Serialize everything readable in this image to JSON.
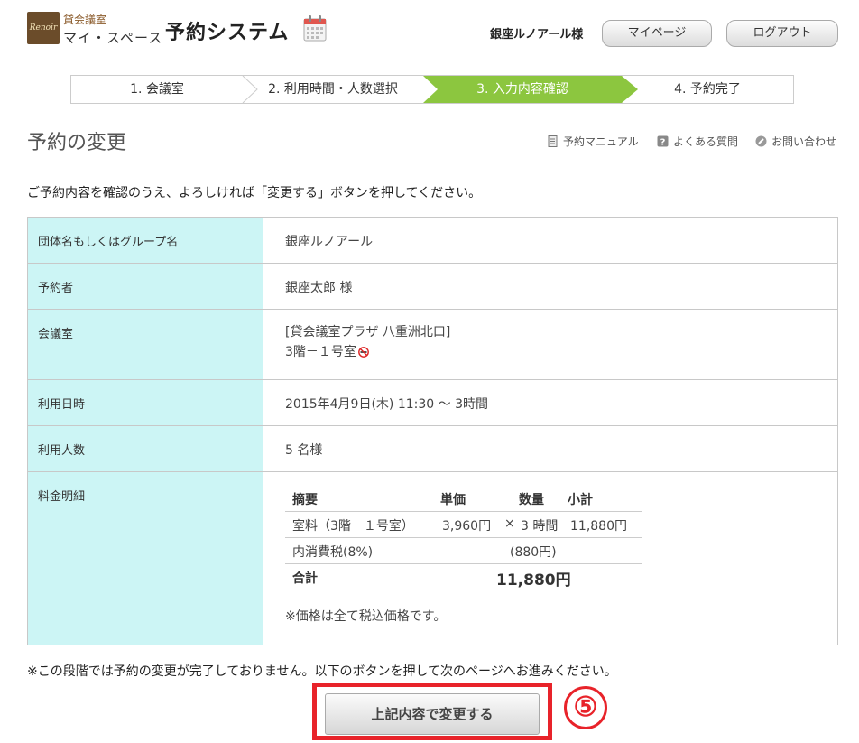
{
  "header": {
    "logo_text": "Renoir",
    "logo_category": "貸会議室",
    "logo_name": "マイ・スペース",
    "system_title": "予約システム",
    "user_name": "銀座ルノアール様",
    "mypage_label": "マイページ",
    "logout_label": "ログアウト"
  },
  "steps": [
    {
      "label": "1. 会議室",
      "active": false
    },
    {
      "label": "2. 利用時間・人数選択",
      "active": false
    },
    {
      "label": "3. 入力内容確認",
      "active": true
    },
    {
      "label": "4. 予約完了",
      "active": false
    }
  ],
  "page": {
    "title": "予約の変更",
    "links": {
      "manual": "予約マニュアル",
      "faq": "よくある質問",
      "contact": "お問い合わせ"
    },
    "instruction": "ご予約内容を確認のうえ、よろしければ「変更する」ボタンを押してください。"
  },
  "details": {
    "group_label": "団体名もしくはグループ名",
    "group_value": "銀座ルノアール",
    "booker_label": "予約者",
    "booker_value": "銀座太郎 様",
    "room_label": "会議室",
    "room_value_line1": "[貸会議室プラザ 八重洲北口]",
    "room_value_line2": "3階－１号室",
    "date_label": "利用日時",
    "date_value": "2015年4月9日(木) 11:30 ～ 3時間",
    "people_label": "利用人数",
    "people_value": "5 名様",
    "fee_label": "料金明細"
  },
  "fee": {
    "headers": {
      "summary": "摘要",
      "unit_price": "単価",
      "quantity": "数量",
      "subtotal": "小計"
    },
    "room_row": {
      "summary": "室料（3階－１号室）",
      "unit_price": "3,960円",
      "times": "×",
      "quantity": "3 時間",
      "subtotal": "11,880円"
    },
    "tax_row": {
      "summary": "内消費税(8%)",
      "amount": "(880円)"
    },
    "total_row": {
      "label": "合計",
      "amount": "11,880円"
    },
    "note": "※価格は全て税込価格です。"
  },
  "footer": {
    "notice": "※この段階では予約の変更が完了しておりません。以下のボタンを押して次のページへお進みください。",
    "submit_label": "上記内容で変更する",
    "step_mark": "⑤"
  },
  "colors": {
    "active_step": "#8cc63f",
    "label_cell": "#ccf5f5",
    "highlight": "#e8232a"
  }
}
